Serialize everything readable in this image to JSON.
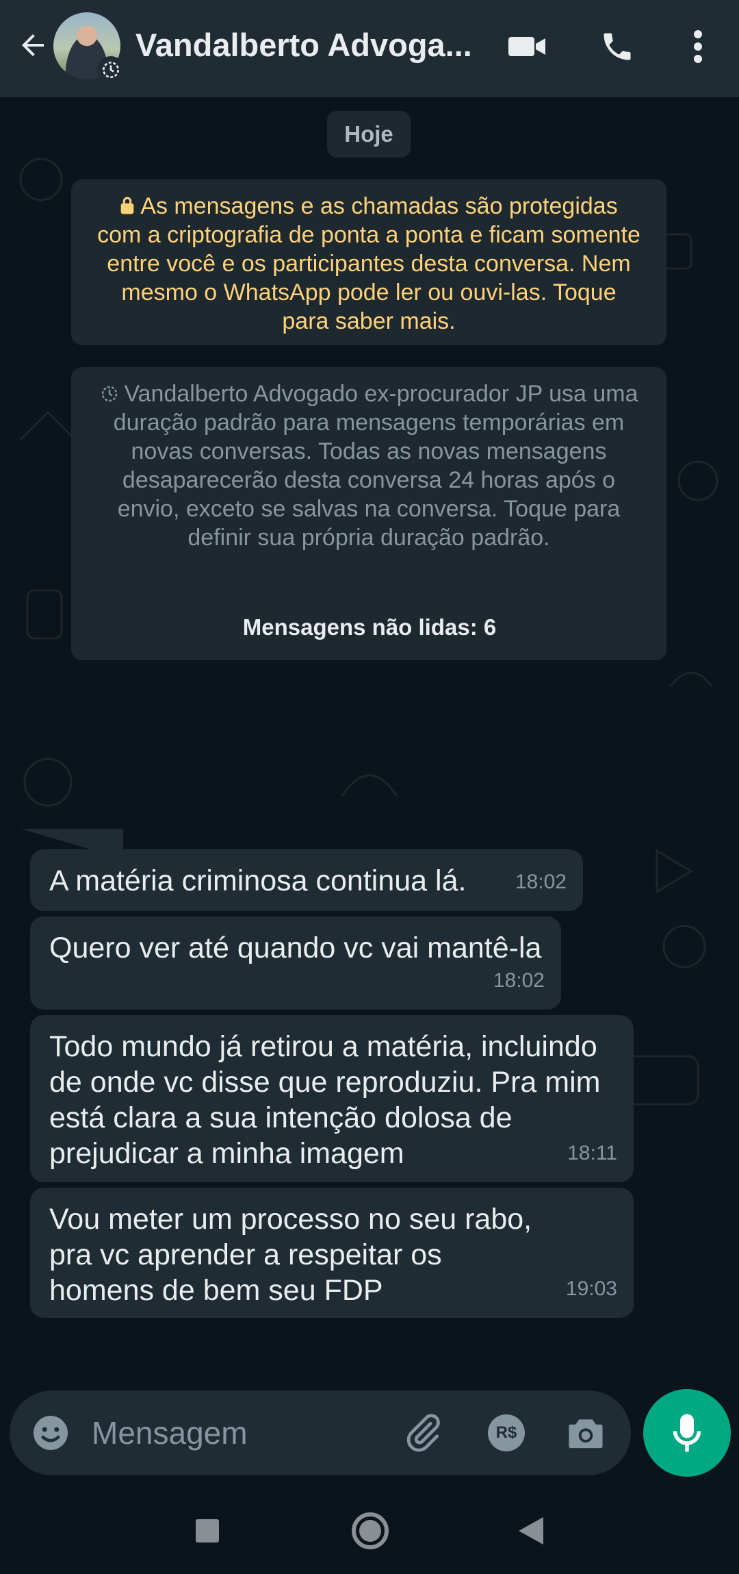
{
  "header": {
    "contact_name": "Vandalberto Advoga...",
    "icons": [
      "back-arrow-icon",
      "video-call-icon",
      "voice-call-icon",
      "more-options-icon"
    ]
  },
  "chat": {
    "date_label": "Hoje",
    "encryption_notice": "As mensagens e as chamadas são protegidas com a criptografia de ponta a ponta e ficam somente entre você e os participantes desta conversa. Nem mesmo o WhatsApp pode ler ou ouvi-las. Toque para saber mais.",
    "disappearing_notice": "Vandalberto Advogado ex-procurador JP usa uma duração padrão para mensagens temporárias em novas conversas. Todas as novas mensagens desaparecerão desta conversa 24 horas após o envio, exceto se salvas na conversa. Toque para definir sua própria duração padrão.",
    "unread_label": "Mensagens não lidas: 6",
    "messages": [
      {
        "text": "A matéria criminosa continua lá.",
        "time": "18:02"
      },
      {
        "text": "Quero ver até quando vc vai mantê-la",
        "time": "18:02"
      },
      {
        "text": "Todo mundo já retirou a matéria, incluindo de onde vc disse que reproduziu. Pra mim está clara a sua intenção dolosa de prejudicar a minha imagem",
        "time": "18:11"
      },
      {
        "text": "Vou meter um processo no seu rabo, pra vc aprender a respeitar os homens de bem seu FDP",
        "time": "19:03"
      }
    ]
  },
  "composer": {
    "placeholder": "Mensagem",
    "icons": [
      "emoji-icon",
      "attach-icon",
      "payment-icon",
      "camera-icon",
      "mic-icon"
    ],
    "payment_label": "R$"
  },
  "colors": {
    "background": "#0b141a",
    "header": "#1f2c33",
    "bubble": "#202c33",
    "accent": "#00a884",
    "encryption_text": "#ffd279"
  }
}
